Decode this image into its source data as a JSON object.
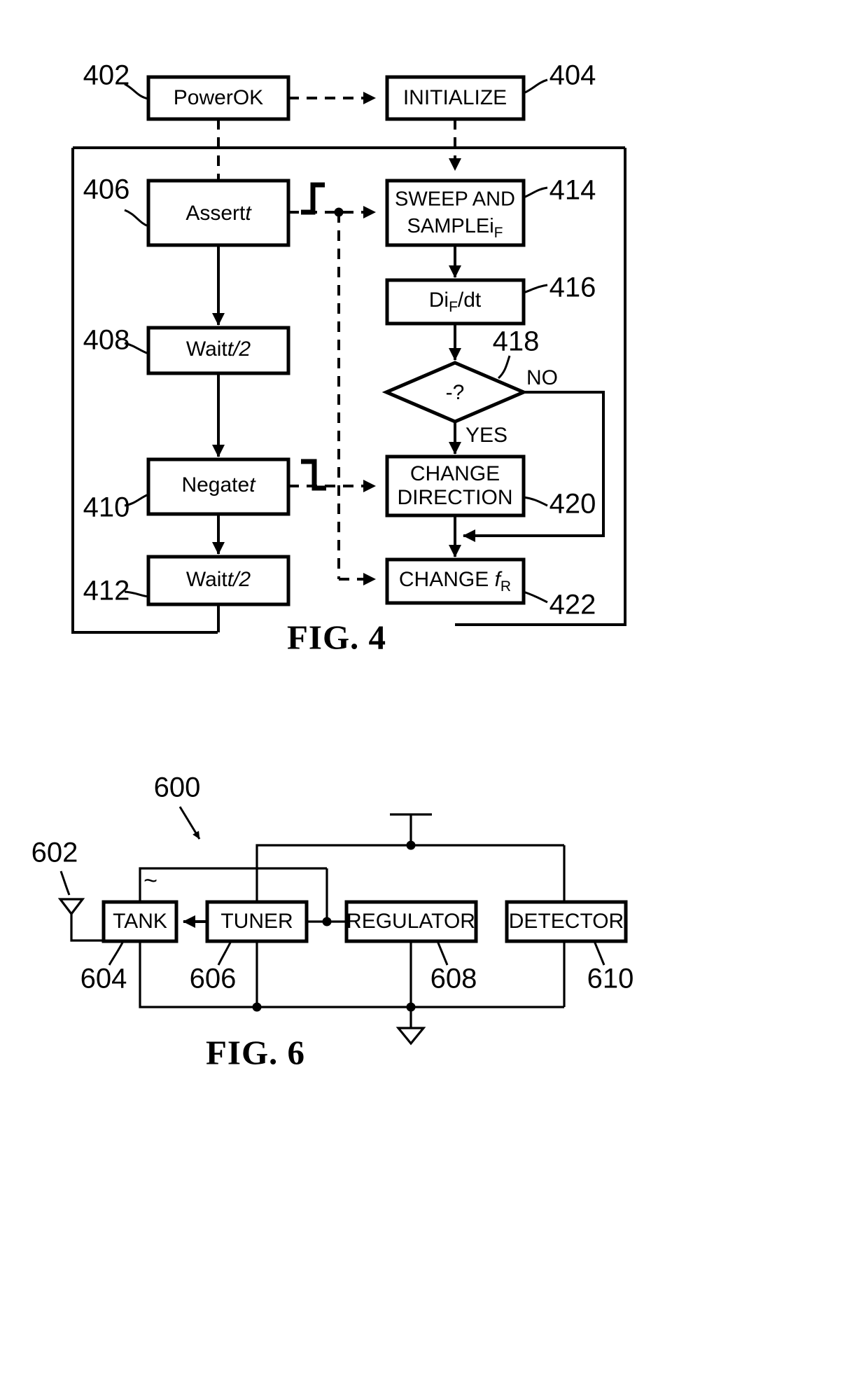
{
  "sheet": {
    "background": "#ffffff",
    "ink": "#000000"
  },
  "figures": [
    {
      "id": "fig4",
      "caption": "FIG. 4",
      "type": "flowchart",
      "nodes": [
        {
          "ref": "402",
          "label": "PowerOK",
          "shape": "rect",
          "italic_tail": ""
        },
        {
          "ref": "404",
          "label": "INITIALIZE",
          "shape": "rect",
          "italic_tail": ""
        },
        {
          "ref": "406",
          "label": "Assert",
          "shape": "rect",
          "italic_tail": "t"
        },
        {
          "ref": "408",
          "label": "Wait",
          "shape": "rect",
          "italic_tail": "t/2"
        },
        {
          "ref": "410",
          "label": "Negate",
          "shape": "rect",
          "italic_tail": "t"
        },
        {
          "ref": "412",
          "label": "Wait",
          "shape": "rect",
          "italic_tail": "t/2"
        },
        {
          "ref": "414",
          "label": "SWEEP AND SAMPLEi",
          "label_line1": "SWEEP AND",
          "label_line2": "SAMPLEi",
          "subscript": "F",
          "shape": "rect",
          "italic_tail": ""
        },
        {
          "ref": "416",
          "label": "Di/dt",
          "label_pre": "Di",
          "subscript": "F",
          "label_post": "/dt",
          "shape": "rect",
          "italic_tail": ""
        },
        {
          "ref": "418",
          "label": "-?",
          "shape": "diamond",
          "italic_tail": ""
        },
        {
          "ref": "420",
          "label": "CHANGE DIRECTION",
          "label_line1": "CHANGE",
          "label_line2": "DIRECTION",
          "shape": "rect",
          "italic_tail": ""
        },
        {
          "ref": "422",
          "label": "CHANGE f",
          "label_pre": "CHANGE ",
          "italic_mid": "f",
          "subscript": "R",
          "shape": "rect",
          "italic_tail": ""
        }
      ],
      "branch_labels": [
        "NO",
        "YES"
      ],
      "signal_icons": [
        {
          "name": "rising-edge-icon",
          "from": "406"
        },
        {
          "name": "falling-edge-icon",
          "from": "410"
        }
      ]
    },
    {
      "id": "fig6",
      "caption": "FIG. 6",
      "type": "block-circuit",
      "assembly_ref": "600",
      "nodes": [
        {
          "ref": "602",
          "label": "",
          "shape": "antenna"
        },
        {
          "ref": "604",
          "label": "TANK",
          "shape": "rect"
        },
        {
          "ref": "606",
          "label": "TUNER",
          "shape": "rect"
        },
        {
          "ref": "608",
          "label": "REGULATOR",
          "shape": "rect"
        },
        {
          "ref": "610",
          "label": "DETECTOR",
          "shape": "rect"
        }
      ],
      "ac_marker": "~"
    }
  ]
}
